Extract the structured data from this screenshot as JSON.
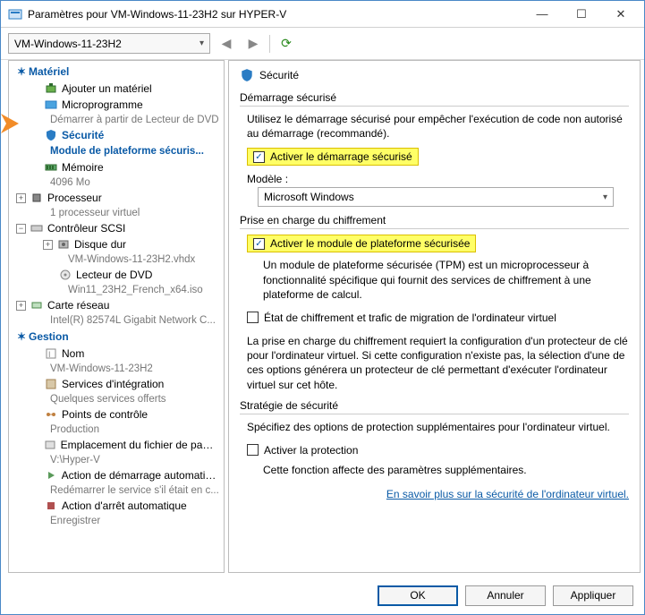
{
  "window": {
    "title": "Paramètres pour VM-Windows-11-23H2 sur HYPER-V"
  },
  "toolbar": {
    "vm_name": "VM-Windows-11-23H2"
  },
  "sidebar": {
    "hw_header": "Matériel",
    "add_hw": "Ajouter un matériel",
    "firmware": "Microprogramme",
    "firmware_sub": "Démarrer à partir de Lecteur de DVD",
    "security": "Sécurité",
    "security_sub": "Module de plateforme sécuris...",
    "memory": "Mémoire",
    "memory_sub": "4096 Mo",
    "cpu": "Processeur",
    "cpu_sub": "1 processeur virtuel",
    "scsi": "Contrôleur SCSI",
    "hdd": "Disque dur",
    "hdd_sub": "VM-Windows-11-23H2.vhdx",
    "dvd": "Lecteur de DVD",
    "dvd_sub": "Win11_23H2_French_x64.iso",
    "nic": "Carte réseau",
    "nic_sub": "Intel(R) 82574L Gigabit Network C...",
    "mgmt_header": "Gestion",
    "name": "Nom",
    "name_sub": "VM-Windows-11-23H2",
    "integration": "Services d'intégration",
    "integration_sub": "Quelques services offerts",
    "checkpoint": "Points de contrôle",
    "checkpoint_sub": "Production",
    "pagefile": "Emplacement du fichier de paginati...",
    "pagefile_sub": "V:\\Hyper-V",
    "autostart": "Action de démarrage automatique",
    "autostart_sub": "Redémarrer le service s'il était en c...",
    "autostop": "Action d'arrêt automatique",
    "autostop_sub": "Enregistrer"
  },
  "content": {
    "title": "Sécurité",
    "secure_boot_group": "Démarrage sécurisé",
    "secure_boot_desc": "Utilisez le démarrage sécurisé pour empêcher l'exécution de code non autorisé au démarrage (recommandé).",
    "secure_boot_check": "Activer le démarrage sécurisé",
    "template_label": "Modèle :",
    "template_value": "Microsoft Windows",
    "enc_group": "Prise en charge du chiffrement",
    "tpm_check": "Activer le module de plateforme sécurisée",
    "tpm_desc": "Un module de plateforme sécurisée (TPM) est un microprocesseur à fonctionnalité spécifique qui fournit des services de chiffrement à une plateforme de calcul.",
    "state_check": "État de chiffrement et trafic de migration de l'ordinateur virtuel",
    "enc_desc": "La prise en charge du chiffrement requiert la configuration d'un protecteur de clé pour l'ordinateur virtuel. Si cette configuration n'existe pas, la sélection d'une de ces options générera un protecteur de clé permettant d'exécuter l'ordinateur virtuel sur cet hôte.",
    "policy_group": "Stratégie de sécurité",
    "policy_desc": "Spécifiez des options de protection supplémentaires pour l'ordinateur virtuel.",
    "shield_check": "Activer la protection",
    "shield_desc": "Cette fonction affecte des paramètres supplémentaires.",
    "learn_more": "En savoir plus sur la sécurité de l'ordinateur virtuel."
  },
  "footer": {
    "ok": "OK",
    "cancel": "Annuler",
    "apply": "Appliquer"
  }
}
